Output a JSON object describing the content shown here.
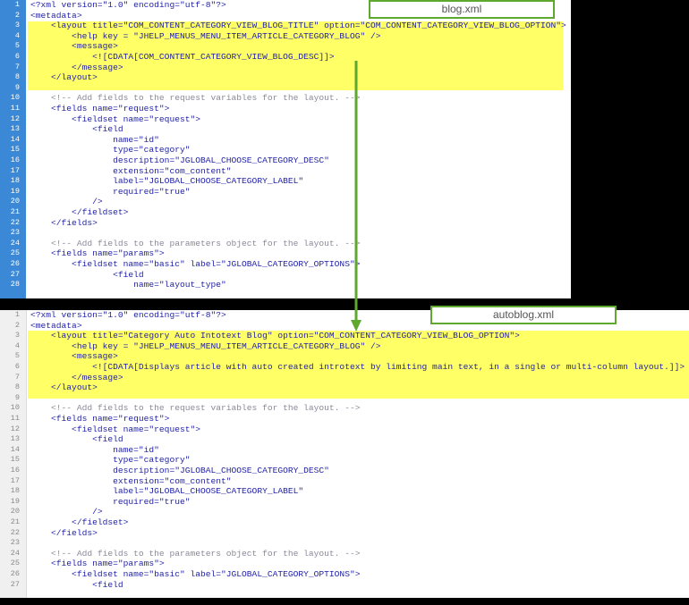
{
  "top_panel": {
    "file_label": "blog.xml",
    "lines": [
      {
        "n": "1",
        "text": "<?xml version=\"1.0\" encoding=\"utf-8\"?>",
        "type": "code"
      },
      {
        "n": "2",
        "text": "<metadata>",
        "type": "code"
      },
      {
        "n": "3",
        "text": "    <layout title=\"COM_CONTENT_CATEGORY_VIEW_BLOG_TITLE\" option=\"COM_CONTENT_CATEGORY_VIEW_BLOG_OPTION\">",
        "type": "code"
      },
      {
        "n": "4",
        "text": "        <help key = \"JHELP_MENUS_MENU_ITEM_ARTICLE_CATEGORY_BLOG\" />",
        "type": "code"
      },
      {
        "n": "5",
        "text": "        <message>",
        "type": "code"
      },
      {
        "n": "6",
        "text": "            <![CDATA[COM_CONTENT_CATEGORY_VIEW_BLOG_DESC]]>",
        "type": "code"
      },
      {
        "n": "7",
        "text": "        </message>",
        "type": "code"
      },
      {
        "n": "8",
        "text": "    </layout>",
        "type": "code"
      },
      {
        "n": "9",
        "text": "",
        "type": "code"
      },
      {
        "n": "10",
        "text": "    <!-- Add fields to the request variables for the layout. -->",
        "type": "comment"
      },
      {
        "n": "11",
        "text": "    <fields name=\"request\">",
        "type": "code"
      },
      {
        "n": "12",
        "text": "        <fieldset name=\"request\">",
        "type": "code"
      },
      {
        "n": "13",
        "text": "            <field",
        "type": "code"
      },
      {
        "n": "14",
        "text": "                name=\"id\"",
        "type": "code"
      },
      {
        "n": "15",
        "text": "                type=\"category\"",
        "type": "code"
      },
      {
        "n": "16",
        "text": "                description=\"JGLOBAL_CHOOSE_CATEGORY_DESC\"",
        "type": "code"
      },
      {
        "n": "17",
        "text": "                extension=\"com_content\"",
        "type": "code"
      },
      {
        "n": "18",
        "text": "                label=\"JGLOBAL_CHOOSE_CATEGORY_LABEL\"",
        "type": "code"
      },
      {
        "n": "19",
        "text": "                required=\"true\"",
        "type": "code"
      },
      {
        "n": "20",
        "text": "            />",
        "type": "code"
      },
      {
        "n": "21",
        "text": "        </fieldset>",
        "type": "code"
      },
      {
        "n": "22",
        "text": "    </fields>",
        "type": "code"
      },
      {
        "n": "23",
        "text": "",
        "type": "code"
      },
      {
        "n": "24",
        "text": "    <!-- Add fields to the parameters object for the layout. -->",
        "type": "comment"
      },
      {
        "n": "25",
        "text": "    <fields name=\"params\">",
        "type": "code"
      },
      {
        "n": "26",
        "text": "        <fieldset name=\"basic\" label=\"JGLOBAL_CATEGORY_OPTIONS\">",
        "type": "code"
      },
      {
        "n": "27",
        "text": "                <field",
        "type": "code"
      },
      {
        "n": "28",
        "text": "                    name=\"layout_type\"",
        "type": "code"
      }
    ]
  },
  "bottom_panel": {
    "file_label": "autoblog.xml",
    "lines": [
      {
        "n": "1",
        "text": "<?xml version=\"1.0\" encoding=\"utf-8\"?>",
        "type": "code"
      },
      {
        "n": "2",
        "text": "<metadata>",
        "type": "code"
      },
      {
        "n": "3",
        "text": "    <layout title=\"Category Auto Intotext Blog\" option=\"COM_CONTENT_CATEGORY_VIEW_BLOG_OPTION\">",
        "type": "code"
      },
      {
        "n": "4",
        "text": "        <help key = \"JHELP_MENUS_MENU_ITEM_ARTICLE_CATEGORY_BLOG\" />",
        "type": "code"
      },
      {
        "n": "5",
        "text": "        <message>",
        "type": "code"
      },
      {
        "n": "6",
        "text": "            <![CDATA[Displays article with auto created introtext by limiting main text, in a single or multi-column layout.]]>",
        "type": "code"
      },
      {
        "n": "7",
        "text": "        </message>",
        "type": "code"
      },
      {
        "n": "8",
        "text": "    </layout>",
        "type": "code"
      },
      {
        "n": "9",
        "text": "",
        "type": "code"
      },
      {
        "n": "10",
        "text": "    <!-- Add fields to the request variables for the layout. -->",
        "type": "comment"
      },
      {
        "n": "11",
        "text": "    <fields name=\"request\">",
        "type": "code"
      },
      {
        "n": "12",
        "text": "        <fieldset name=\"request\">",
        "type": "code"
      },
      {
        "n": "13",
        "text": "            <field",
        "type": "code"
      },
      {
        "n": "14",
        "text": "                name=\"id\"",
        "type": "code"
      },
      {
        "n": "15",
        "text": "                type=\"category\"",
        "type": "code"
      },
      {
        "n": "16",
        "text": "                description=\"JGLOBAL_CHOOSE_CATEGORY_DESC\"",
        "type": "code"
      },
      {
        "n": "17",
        "text": "                extension=\"com_content\"",
        "type": "code"
      },
      {
        "n": "18",
        "text": "                label=\"JGLOBAL_CHOOSE_CATEGORY_LABEL\"",
        "type": "code"
      },
      {
        "n": "19",
        "text": "                required=\"true\"",
        "type": "code"
      },
      {
        "n": "20",
        "text": "            />",
        "type": "code"
      },
      {
        "n": "21",
        "text": "        </fieldset>",
        "type": "code"
      },
      {
        "n": "22",
        "text": "    </fields>",
        "type": "code"
      },
      {
        "n": "23",
        "text": "",
        "type": "code"
      },
      {
        "n": "24",
        "text": "    <!-- Add fields to the parameters object for the layout. -->",
        "type": "comment"
      },
      {
        "n": "25",
        "text": "    <fields name=\"params\">",
        "type": "code"
      },
      {
        "n": "26",
        "text": "        <fieldset name=\"basic\" label=\"JGLOBAL_CATEGORY_OPTIONS\">",
        "type": "code"
      },
      {
        "n": "27",
        "text": "            <field",
        "type": "code"
      }
    ]
  },
  "colors": {
    "highlight": "#ffff66",
    "arrow": "#5fa82f",
    "top_gutter": "#3b89d6",
    "code_text": "#1f1fa8",
    "comment_text": "#8a8a9a"
  }
}
